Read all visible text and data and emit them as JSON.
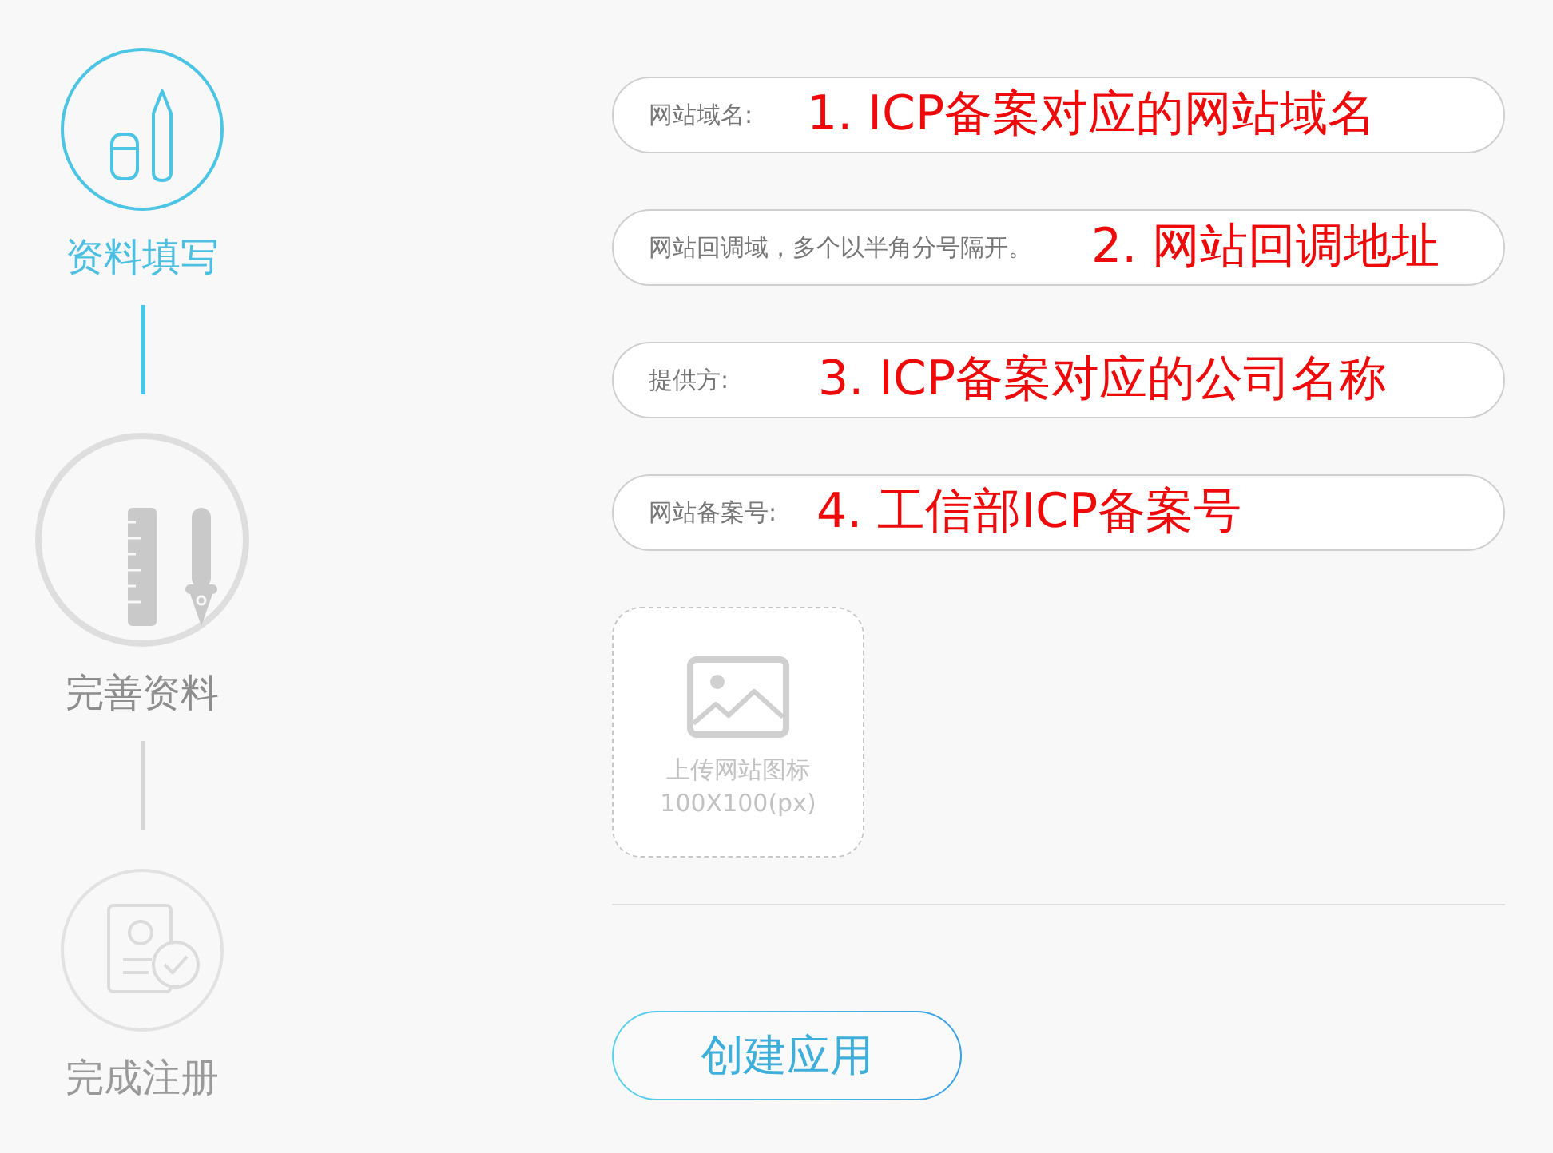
{
  "steps": [
    {
      "label": "资料填写",
      "selected": true,
      "focused": false
    },
    {
      "label": "完善资料",
      "selected": false,
      "focused": true
    },
    {
      "label": "完成注册",
      "selected": false,
      "focused": false
    }
  ],
  "fields": [
    {
      "placeholder": "网站域名:",
      "annotation": "1. ICP备案对应的网站域名"
    },
    {
      "placeholder": "网站回调域，多个以半角分号隔开。",
      "annotation": "2. 网站回调地址"
    },
    {
      "placeholder": "提供方:",
      "annotation": "3. ICP备案对应的公司名称"
    },
    {
      "placeholder": "网站备案号:",
      "annotation": "4. 工信部ICP备案号"
    }
  ],
  "upload": {
    "label": "上传网站图标",
    "size_hint": "100X100(px)"
  },
  "submit_button": {
    "label": "创建应用"
  }
}
